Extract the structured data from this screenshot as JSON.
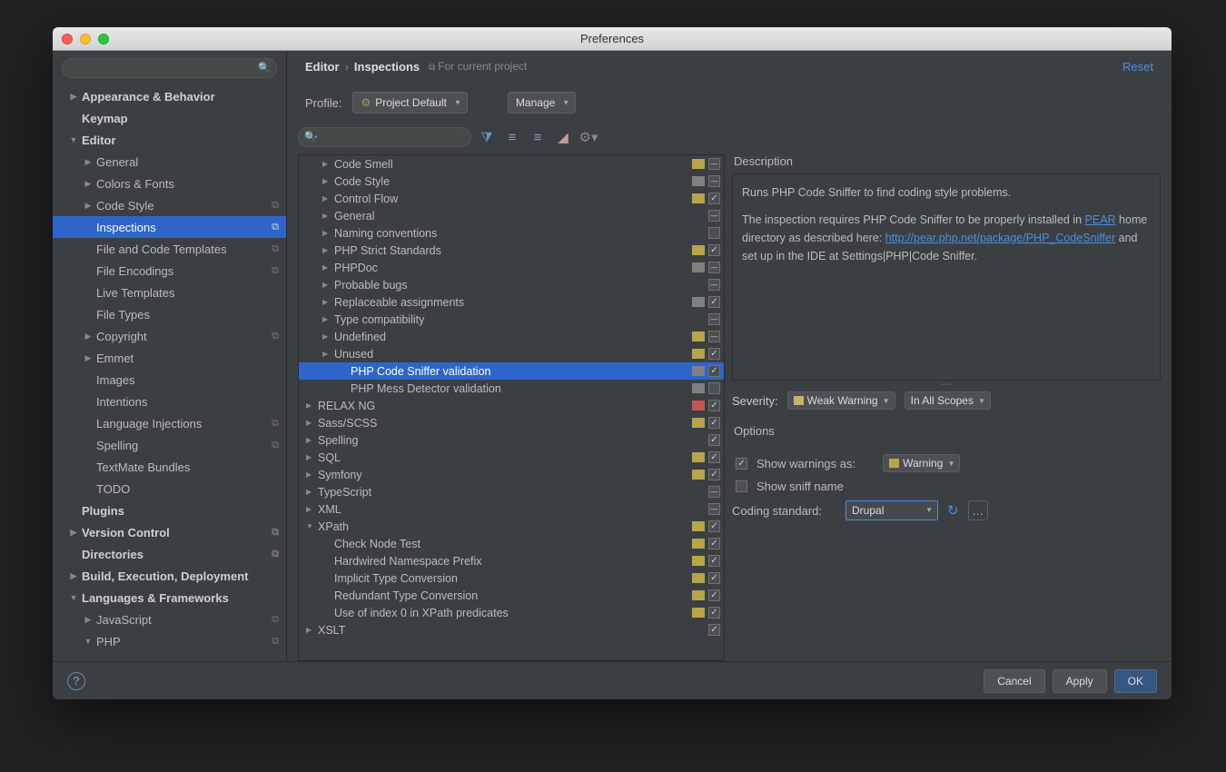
{
  "window": {
    "title": "Preferences"
  },
  "breadcrumb": {
    "part1": "Editor",
    "part2": "Inspections",
    "context": "For current project",
    "reset": "Reset"
  },
  "profile": {
    "label": "Profile:",
    "value": "Project Default",
    "manage_label": "Manage"
  },
  "sidebar": [
    {
      "label": "Appearance & Behavior",
      "indent": 0,
      "arrow": "▶",
      "bold": true
    },
    {
      "label": "Keymap",
      "indent": 0,
      "bold": true
    },
    {
      "label": "Editor",
      "indent": 0,
      "arrow": "▼",
      "bold": true
    },
    {
      "label": "General",
      "indent": 1,
      "arrow": "▶"
    },
    {
      "label": "Colors & Fonts",
      "indent": 1,
      "arrow": "▶"
    },
    {
      "label": "Code Style",
      "indent": 1,
      "arrow": "▶",
      "ricon": "⧉"
    },
    {
      "label": "Inspections",
      "indent": 1,
      "selected": true,
      "ricon": "⧉"
    },
    {
      "label": "File and Code Templates",
      "indent": 1,
      "ricon": "⧉"
    },
    {
      "label": "File Encodings",
      "indent": 1,
      "ricon": "⧉"
    },
    {
      "label": "Live Templates",
      "indent": 1
    },
    {
      "label": "File Types",
      "indent": 1
    },
    {
      "label": "Copyright",
      "indent": 1,
      "arrow": "▶",
      "ricon": "⧉"
    },
    {
      "label": "Emmet",
      "indent": 1,
      "arrow": "▶"
    },
    {
      "label": "Images",
      "indent": 1
    },
    {
      "label": "Intentions",
      "indent": 1
    },
    {
      "label": "Language Injections",
      "indent": 1,
      "ricon": "⧉"
    },
    {
      "label": "Spelling",
      "indent": 1,
      "ricon": "⧉"
    },
    {
      "label": "TextMate Bundles",
      "indent": 1
    },
    {
      "label": "TODO",
      "indent": 1
    },
    {
      "label": "Plugins",
      "indent": 0,
      "bold": true
    },
    {
      "label": "Version Control",
      "indent": 0,
      "arrow": "▶",
      "bold": true,
      "ricon": "⧉"
    },
    {
      "label": "Directories",
      "indent": 0,
      "bold": true,
      "ricon": "⧉"
    },
    {
      "label": "Build, Execution, Deployment",
      "indent": 0,
      "arrow": "▶",
      "bold": true
    },
    {
      "label": "Languages & Frameworks",
      "indent": 0,
      "arrow": "▼",
      "bold": true
    },
    {
      "label": "JavaScript",
      "indent": 1,
      "arrow": "▶",
      "ricon": "⧉"
    },
    {
      "label": "PHP",
      "indent": 1,
      "arrow": "▼",
      "ricon": "⧉"
    }
  ],
  "inspections": [
    {
      "label": "Code Smell",
      "indent": 1,
      "arrow": "▶",
      "color": "#b8a54a",
      "cb": "dash"
    },
    {
      "label": "Code Style",
      "indent": 1,
      "arrow": "▶",
      "color": "#808080",
      "cb": "dash"
    },
    {
      "label": "Control Flow",
      "indent": 1,
      "arrow": "▶",
      "color": "#b8a54a",
      "cb": "checked"
    },
    {
      "label": "General",
      "indent": 1,
      "arrow": "▶",
      "color": "",
      "cb": "dash"
    },
    {
      "label": "Naming conventions",
      "indent": 1,
      "arrow": "▶",
      "color": "",
      "cb": "empty"
    },
    {
      "label": "PHP Strict Standards",
      "indent": 1,
      "arrow": "▶",
      "color": "#b8a54a",
      "cb": "checked"
    },
    {
      "label": "PHPDoc",
      "indent": 1,
      "arrow": "▶",
      "color": "#808080",
      "cb": "dash"
    },
    {
      "label": "Probable bugs",
      "indent": 1,
      "arrow": "▶",
      "color": "",
      "cb": "dash"
    },
    {
      "label": "Replaceable assignments",
      "indent": 1,
      "arrow": "▶",
      "color": "#808080",
      "cb": "checked"
    },
    {
      "label": "Type compatibility",
      "indent": 1,
      "arrow": "▶",
      "color": "",
      "cb": "dash"
    },
    {
      "label": "Undefined",
      "indent": 1,
      "arrow": "▶",
      "color": "#b8a54a",
      "cb": "dash"
    },
    {
      "label": "Unused",
      "indent": 1,
      "arrow": "▶",
      "color": "#b8a54a",
      "cb": "checked"
    },
    {
      "label": "PHP Code Sniffer validation",
      "indent": 2,
      "selected": true,
      "color": "#808080",
      "cb": "checked"
    },
    {
      "label": "PHP Mess Detector validation",
      "indent": 2,
      "color": "#808080",
      "cb": "empty"
    },
    {
      "label": "RELAX NG",
      "indent": 0,
      "arrow": "▶",
      "color": "#c75450",
      "cb": "checked"
    },
    {
      "label": "Sass/SCSS",
      "indent": 0,
      "arrow": "▶",
      "color": "#b8a54a",
      "cb": "checked"
    },
    {
      "label": "Spelling",
      "indent": 0,
      "arrow": "▶",
      "color": "",
      "cb": "checked"
    },
    {
      "label": "SQL",
      "indent": 0,
      "arrow": "▶",
      "color": "#b8a54a",
      "cb": "checked"
    },
    {
      "label": "Symfony",
      "indent": 0,
      "arrow": "▶",
      "color": "#b8a54a",
      "cb": "checked"
    },
    {
      "label": "TypeScript",
      "indent": 0,
      "arrow": "▶",
      "color": "",
      "cb": "dash"
    },
    {
      "label": "XML",
      "indent": 0,
      "arrow": "▶",
      "color": "",
      "cb": "dash"
    },
    {
      "label": "XPath",
      "indent": 0,
      "arrow": "▼",
      "color": "#b8a54a",
      "cb": "checked"
    },
    {
      "label": "Check Node Test",
      "indent": 1,
      "color": "#b8a54a",
      "cb": "checked"
    },
    {
      "label": "Hardwired Namespace Prefix",
      "indent": 1,
      "color": "#b8a54a",
      "cb": "checked"
    },
    {
      "label": "Implicit Type Conversion",
      "indent": 1,
      "color": "#b8a54a",
      "cb": "checked"
    },
    {
      "label": "Redundant Type Conversion",
      "indent": 1,
      "color": "#b8a54a",
      "cb": "checked"
    },
    {
      "label": "Use of index 0 in XPath predicates",
      "indent": 1,
      "color": "#b8a54a",
      "cb": "checked"
    },
    {
      "label": "XSLT",
      "indent": 0,
      "arrow": "▶",
      "color": "",
      "cb": "checked"
    }
  ],
  "desc": {
    "header": "Description",
    "p1": "Runs PHP Code Sniffer to find coding style problems.",
    "p2a": "The inspection requires PHP Code Sniffer to be properly installed in ",
    "p2link1": "PEAR",
    "p2b": " home directory as described here: ",
    "p2link2": "http://pear.php.net/package/PHP_CodeSniffer",
    "p2c": " and set up in the IDE at Settings|PHP|Code Sniffer."
  },
  "severity": {
    "label": "Severity:",
    "value": "Weak Warning",
    "scope": "In All Scopes",
    "color": "#c9b26a"
  },
  "options": {
    "header": "Options",
    "show_warnings_label": "Show warnings as:",
    "show_warnings_value": "Warning",
    "show_warnings_color": "#b8a54a",
    "show_sniff_label": "Show sniff name",
    "coding_standard_label": "Coding standard:",
    "coding_standard_value": "Drupal"
  },
  "footer": {
    "cancel": "Cancel",
    "apply": "Apply",
    "ok": "OK"
  }
}
